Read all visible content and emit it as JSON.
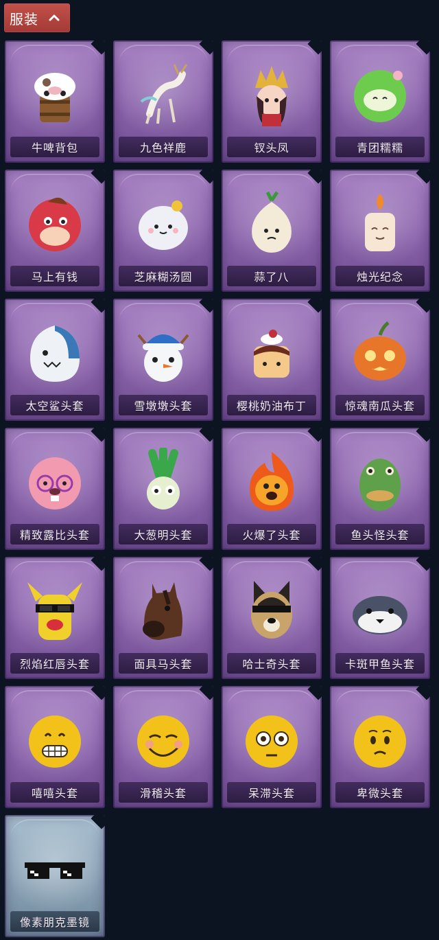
{
  "section": {
    "title": "服装",
    "expanded": true,
    "accent": "#b0443f"
  },
  "items": [
    {
      "name": "牛啤背包",
      "icon": "cow-beer-backpack"
    },
    {
      "name": "九色祥鹿",
      "icon": "deer"
    },
    {
      "name": "钗头凤",
      "icon": "phoenix-crown-girl"
    },
    {
      "name": "青团糯糯",
      "icon": "green-rice-ball"
    },
    {
      "name": "马上有钱",
      "icon": "red-horse"
    },
    {
      "name": "芝麻糊汤圆",
      "icon": "rice-dumpling"
    },
    {
      "name": "蒜了八",
      "icon": "garlic"
    },
    {
      "name": "烛光纪念",
      "icon": "candle"
    },
    {
      "name": "太空鲨头套",
      "icon": "shark-helmet"
    },
    {
      "name": "雪墩墩头套",
      "icon": "snowman-helmet"
    },
    {
      "name": "樱桃奶油布丁",
      "icon": "cherry-pudding"
    },
    {
      "name": "惊魂南瓜头套",
      "icon": "pumpkin-helmet"
    },
    {
      "name": "精致露比头套",
      "icon": "pink-beaver-helmet"
    },
    {
      "name": "大葱明头套",
      "icon": "scallion-helmet"
    },
    {
      "name": "火爆了头套",
      "icon": "fire-helmet"
    },
    {
      "name": "鱼头怪头套",
      "icon": "fish-head-helmet"
    },
    {
      "name": "烈焰红唇头套",
      "icon": "yellow-mascot-helmet"
    },
    {
      "name": "面具马头套",
      "icon": "horse-mask"
    },
    {
      "name": "哈士奇头套",
      "icon": "husky-helmet"
    },
    {
      "name": "卡斑甲鱼头套",
      "icon": "seal-helmet"
    },
    {
      "name": "嘻嘻头套",
      "icon": "grin-emoji-helmet"
    },
    {
      "name": "滑稽头套",
      "icon": "smirk-emoji-helmet"
    },
    {
      "name": "呆滞头套",
      "icon": "stare-emoji-helmet"
    },
    {
      "name": "卑微头套",
      "icon": "humble-emoji-helmet"
    },
    {
      "name": "像素朋克墨镜",
      "icon": "pixel-sunglasses",
      "rarity": "blue"
    }
  ]
}
